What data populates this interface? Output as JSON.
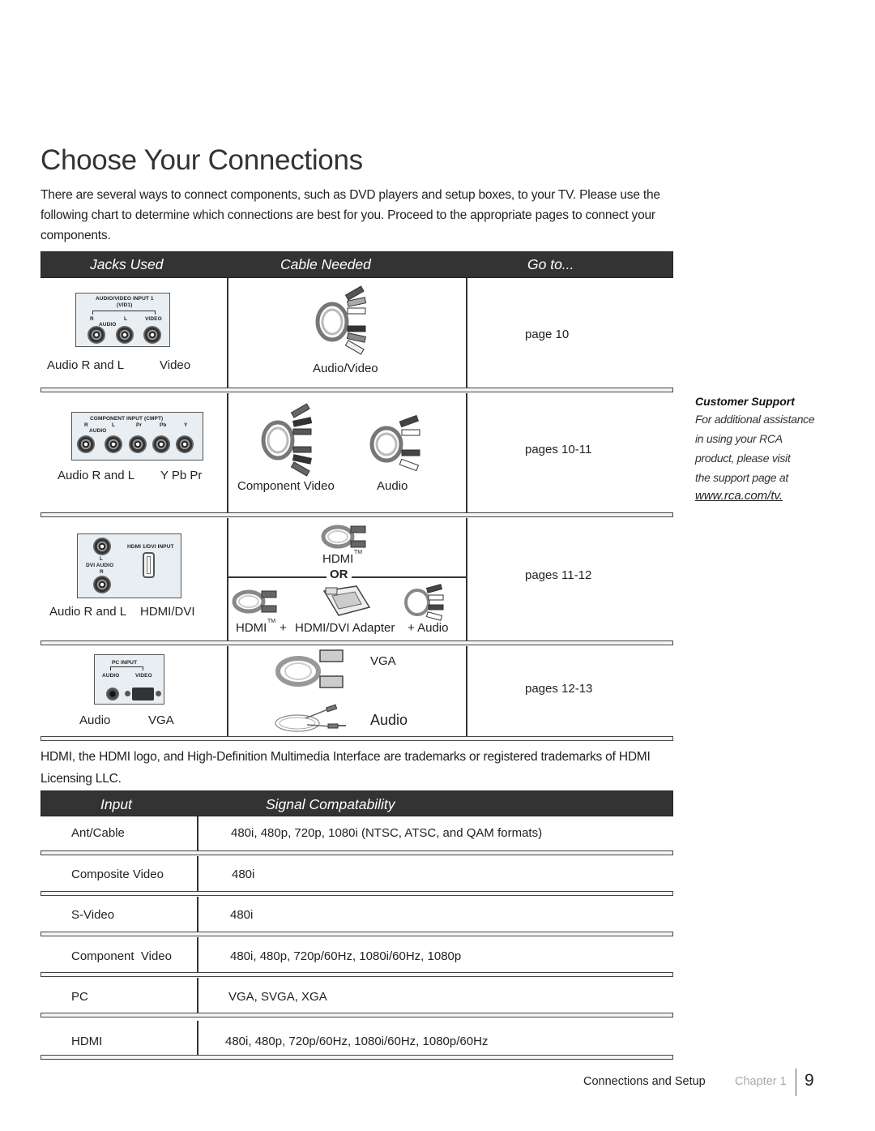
{
  "page": {
    "title": "Choose Your Connections",
    "intro": "There are several ways to connect components, such as DVD players and setup boxes, to your TV. Please use the following chart to determine which connections are best for you. Proceed to the appropriate pages to connect your components."
  },
  "connections_table": {
    "headers": [
      "Jacks Used",
      "Cable Needed",
      "Go to..."
    ],
    "rows": [
      {
        "panel": {
          "title": "AUDIO/VIDEO INPUT 1",
          "subtitle": "(VID1)",
          "labels": [
            "R",
            "L",
            "VIDEO",
            "AUDIO"
          ]
        },
        "jacks": [
          "Audio R and L",
          "Video"
        ],
        "cables": [
          "Audio/Video"
        ],
        "goto": "page 10"
      },
      {
        "panel": {
          "title": "COMPONENT INPUT (CMPT)",
          "labels": [
            "R",
            "L",
            "Pr",
            "Pb",
            "Y",
            "AUDIO"
          ]
        },
        "jacks": [
          "Audio R and L",
          "Y Pb Pr"
        ],
        "cables": [
          "Component Video",
          "Audio"
        ],
        "goto": "pages 10-11"
      },
      {
        "panel": {
          "title": "HDMI 1/DVI INPUT",
          "labels": [
            "L",
            "DVI AUDIO",
            "R"
          ]
        },
        "jacks": [
          "Audio R and L",
          "HDMI/DVI"
        ],
        "cables": [
          "HDMI",
          "TM",
          "OR",
          "HDMI",
          "TM",
          "+",
          "HDMI/DVI Adapter",
          "+ Audio"
        ],
        "goto": "pages 11-12"
      },
      {
        "panel": {
          "title": "PC INPUT",
          "labels": [
            "AUDIO",
            "VIDEO"
          ]
        },
        "jacks": [
          "Audio",
          "VGA"
        ],
        "cables": [
          "VGA",
          "Audio"
        ],
        "goto": "pages 12-13"
      }
    ]
  },
  "sidebar": {
    "title": "Customer Support",
    "lines": [
      "For additional assistance",
      "in using your RCA",
      "product, please visit",
      "the support page at"
    ],
    "link": "www.rca.com/tv."
  },
  "trademark_note": "HDMI, the HDMI logo, and High-Definition Multimedia Interface are trademarks or registered trademarks of HDMI Licensing LLC.",
  "signal_table": {
    "headers": [
      "Input",
      "Signal Compatability"
    ],
    "rows": [
      {
        "input": "Ant/Cable",
        "signal": "480i, 480p, 720p, 1080i (NTSC, ATSC, and QAM formats)"
      },
      {
        "input": "Composite Video",
        "signal": "480i"
      },
      {
        "input": "S-Video",
        "signal": "480i"
      },
      {
        "input": "Component  Video",
        "signal": "480i, 480p, 720p/60Hz, 1080i/60Hz, 1080p"
      },
      {
        "input": "PC",
        "signal": "VGA, SVGA, XGA"
      },
      {
        "input": "HDMI",
        "signal": "480i, 480p, 720p/60Hz, 1080i/60Hz, 1080p/60Hz"
      }
    ]
  },
  "footer": {
    "section": "Connections and Setup",
    "chapter": "Chapter 1",
    "page_number": "9"
  }
}
